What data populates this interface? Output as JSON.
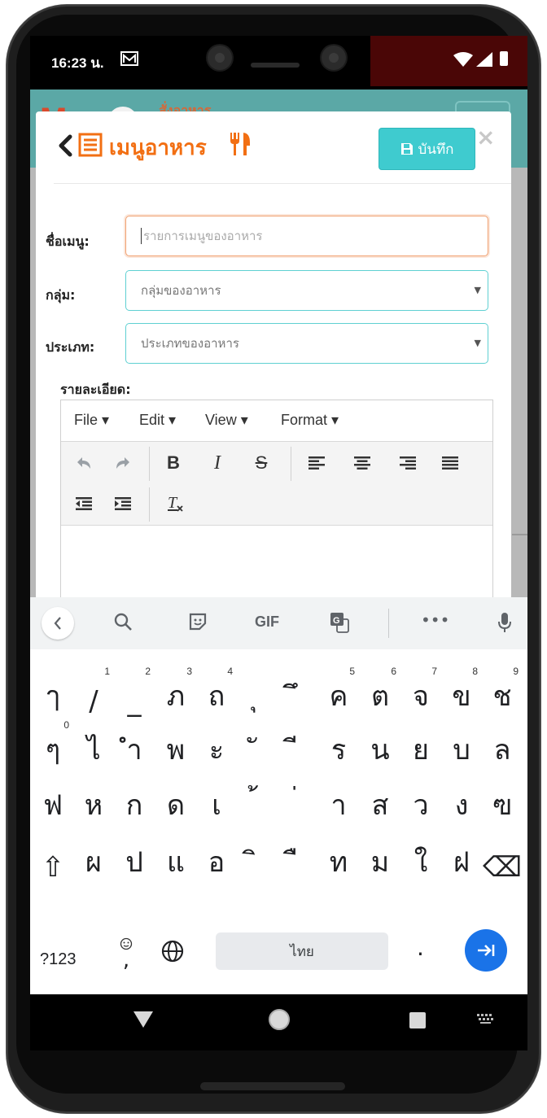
{
  "status_bar": {
    "time": "16:23 น.",
    "icons": [
      "mail-icon",
      "wifi-icon",
      "signal-icon",
      "battery-icon"
    ]
  },
  "app_background": {
    "header_text": "สั่งอาหาร",
    "brand_color": "#5ba8a6"
  },
  "modal": {
    "title": "เมนูอาหาร",
    "save_label": "บันทึก",
    "close_label": "×",
    "accent_color": "#f26f13",
    "save_color": "#3fcbcf"
  },
  "form": {
    "menu_name": {
      "label": "ชื่อเมนู:",
      "placeholder": "รายการเมนูของอาหาร",
      "value": ""
    },
    "group": {
      "label": "กลุ่ม:",
      "selected": "กลุ่มของอาหาร"
    },
    "type": {
      "label": "ประเภท:",
      "selected": "ประเภทของอาหาร"
    },
    "details_label": "รายละเอียด:"
  },
  "editor": {
    "menus": [
      {
        "label": "File ▾"
      },
      {
        "label": "Edit ▾"
      },
      {
        "label": "View ▾"
      },
      {
        "label": "Format ▾"
      }
    ],
    "toolbar": {
      "undo": "undo-icon",
      "redo": "redo-icon",
      "bold": "B",
      "italic": "I",
      "strike": "S",
      "align": [
        "align-left-icon",
        "align-center-icon",
        "align-right-icon",
        "align-justify-icon"
      ],
      "outdent": "outdent-icon",
      "indent": "indent-icon",
      "clear_format": "clear-format-icon"
    }
  },
  "keyboard": {
    "suggestions": [
      "search-icon",
      "sticker-icon",
      "GIF",
      "translate-icon",
      "•••",
      "mic-icon"
    ],
    "gif_label": "GIF",
    "more_label": "•••",
    "rows": [
      [
        {
          "k": "ๅ",
          "h": ""
        },
        {
          "k": "/",
          "h": "1"
        },
        {
          "k": "_",
          "h": "2"
        },
        {
          "k": "ภ",
          "h": "3"
        },
        {
          "k": "ถ",
          "h": "4"
        },
        {
          "k": "ุ",
          "h": ""
        },
        {
          "k": "ึ",
          "h": ""
        },
        {
          "k": "ค",
          "h": "5"
        },
        {
          "k": "ต",
          "h": "6"
        },
        {
          "k": "จ",
          "h": "7"
        },
        {
          "k": "ข",
          "h": "8"
        },
        {
          "k": "ช",
          "h": "9"
        }
      ],
      [
        {
          "k": "ๆ",
          "h": "0"
        },
        {
          "k": "ไ",
          "h": ""
        },
        {
          "k": "ำ",
          "h": ""
        },
        {
          "k": "พ",
          "h": ""
        },
        {
          "k": "ะ",
          "h": ""
        },
        {
          "k": "ั",
          "h": ""
        },
        {
          "k": "ี",
          "h": ""
        },
        {
          "k": "ร",
          "h": ""
        },
        {
          "k": "น",
          "h": ""
        },
        {
          "k": "ย",
          "h": ""
        },
        {
          "k": "บ",
          "h": ""
        },
        {
          "k": "ล",
          "h": ""
        }
      ],
      [
        {
          "k": "ฟ",
          "h": ""
        },
        {
          "k": "ห",
          "h": ""
        },
        {
          "k": "ก",
          "h": ""
        },
        {
          "k": "ด",
          "h": ""
        },
        {
          "k": "เ",
          "h": ""
        },
        {
          "k": "้",
          "h": ""
        },
        {
          "k": "่",
          "h": ""
        },
        {
          "k": "า",
          "h": ""
        },
        {
          "k": "ส",
          "h": ""
        },
        {
          "k": "ว",
          "h": ""
        },
        {
          "k": "ง",
          "h": ""
        },
        {
          "k": "ฃ",
          "h": ""
        }
      ],
      [
        {
          "k": "⇧",
          "h": ""
        },
        {
          "k": "ผ",
          "h": ""
        },
        {
          "k": "ป",
          "h": ""
        },
        {
          "k": "แ",
          "h": ""
        },
        {
          "k": "อ",
          "h": ""
        },
        {
          "k": "ิ",
          "h": ""
        },
        {
          "k": "ื",
          "h": ""
        },
        {
          "k": "ท",
          "h": ""
        },
        {
          "k": "ม",
          "h": ""
        },
        {
          "k": "ใ",
          "h": ""
        },
        {
          "k": "ฝ",
          "h": ""
        },
        {
          "k": "⌫",
          "h": ""
        }
      ]
    ],
    "symbols_label": "?123",
    "emoji_comma": ",",
    "space_label": "ไทย",
    "period_label": ".",
    "enter_color": "#1a73e8"
  }
}
